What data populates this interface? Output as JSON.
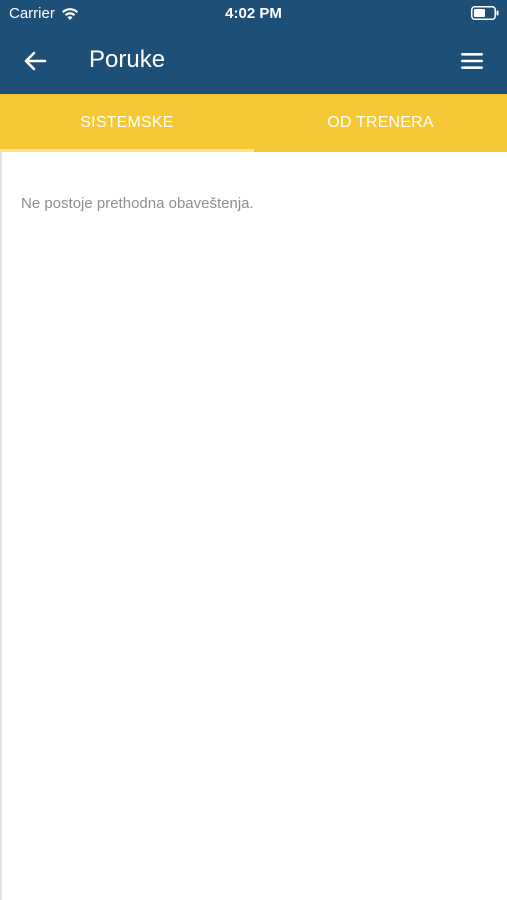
{
  "status_bar": {
    "carrier": "Carrier",
    "time": "4:02 PM",
    "wifi_icon": "wifi-icon",
    "battery_icon": "battery-icon"
  },
  "navbar": {
    "title": "Poruke",
    "back_icon": "arrow-left-icon",
    "menu_icon": "hamburger-menu-icon"
  },
  "tabs": [
    {
      "label": "SISTEMSKE",
      "selected": true
    },
    {
      "label": "OD TRENERA",
      "selected": false
    }
  ],
  "content": {
    "empty_message": "Ne postoje prethodna obaveštenja."
  },
  "colors": {
    "header": "#1e4f77",
    "tabbar": "#f6c835",
    "tab_text": "#ffffff",
    "empty_text": "#8f8f8f"
  }
}
